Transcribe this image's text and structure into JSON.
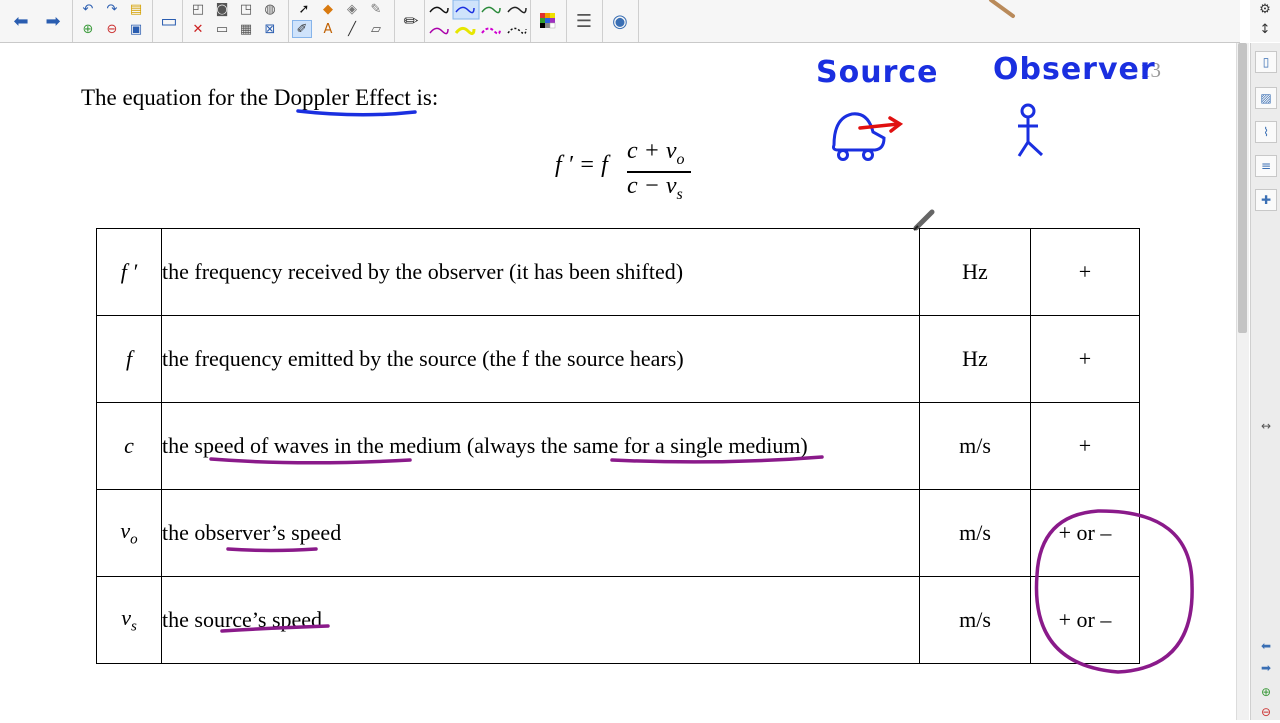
{
  "toolbar": {
    "items": [
      {
        "icon": "back-arrow-icon"
      },
      {
        "icon": "forward-arrow-icon"
      },
      {
        "icon": "undo-icon"
      },
      {
        "icon": "redo-icon"
      },
      {
        "icon": "open-icon"
      },
      {
        "icon": "save-icon"
      },
      {
        "icon": "screen-capture-icon"
      },
      {
        "icon": "delete-icon"
      },
      {
        "icon": "table-icon"
      },
      {
        "icon": "select-arrow-icon"
      },
      {
        "icon": "pen-icon"
      },
      {
        "icon": "eraser-icon"
      },
      {
        "icon": "text-icon"
      },
      {
        "icon": "line-icon"
      },
      {
        "icon": "shape-icon"
      },
      {
        "icon": "color-palette-icon"
      },
      {
        "icon": "properties-icon"
      },
      {
        "icon": "magic-pen-icon"
      }
    ],
    "line_colors": [
      "#111111",
      "#2a8a3a",
      "#cccc00",
      "#aa00aa",
      "#777777"
    ]
  },
  "page": {
    "number": "13",
    "intro": "The equation for the Doppler Effect is:",
    "equation": {
      "lhs": "f ′ = f",
      "numerator": "c + v",
      "numerator_sub": "o",
      "denominator": "c − v",
      "denominator_sub": "s"
    },
    "annotations": {
      "source_label": "Source",
      "observer_label": "Observer"
    },
    "table": {
      "rows": [
        {
          "symbol": "f ′",
          "description": "the frequency received by the observer (it has been shifted)",
          "unit": "Hz",
          "sign": "+"
        },
        {
          "symbol": "f",
          "description": "the frequency emitted by the source (the f  the source hears)",
          "unit": "Hz",
          "sign": "+"
        },
        {
          "symbol": "c",
          "description": "the speed of waves in the medium (always the same for a single medium)",
          "unit": "m/s",
          "sign": "+"
        },
        {
          "symbol": "v",
          "symbol_sub": "o",
          "description": "the observer’s speed",
          "unit": "m/s",
          "sign": "+ or –"
        },
        {
          "symbol": "v",
          "symbol_sub": "s",
          "description": "the source’s speed",
          "unit": "m/s",
          "sign": "+ or –"
        }
      ]
    }
  },
  "ink_colors": {
    "blue": "#1a2fe0",
    "purple": "#8a1a8a",
    "red": "#e01010"
  },
  "sidebar": {
    "tabs": [
      {
        "icon": "page-sorter-icon"
      },
      {
        "icon": "gallery-icon"
      },
      {
        "icon": "attachments-icon"
      },
      {
        "icon": "properties-icon"
      },
      {
        "icon": "addons-icon"
      }
    ]
  }
}
